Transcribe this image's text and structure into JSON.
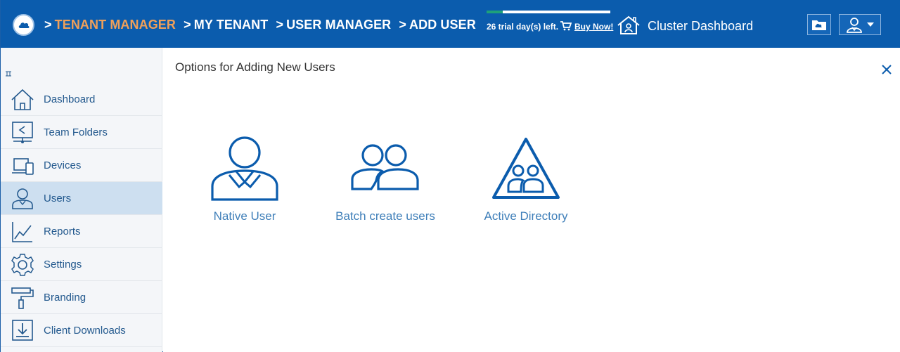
{
  "header": {
    "breadcrumb": [
      {
        "label": "TENANT MANAGER",
        "color": "#f0a05a"
      },
      {
        "label": "MY TENANT",
        "color": "#ffffff"
      },
      {
        "label": "USER MANAGER",
        "color": "#ffffff"
      },
      {
        "label": "ADD USER",
        "color": "#ffffff"
      }
    ],
    "separator": ">",
    "trial_text": "26 trial day(s) left.",
    "trial_progress": 0.13,
    "buy_now": "Buy Now!",
    "cluster_dashboard": "Cluster Dashboard",
    "icons": [
      "cloud-logo-icon",
      "cart-icon",
      "house-icon",
      "folder-icon",
      "user-icon",
      "caret-down-icon"
    ]
  },
  "sidebar": {
    "items": [
      {
        "label": "Dashboard",
        "icon": "home-icon",
        "active": false
      },
      {
        "label": "Team Folders",
        "icon": "team-folder-icon",
        "active": false
      },
      {
        "label": "Devices",
        "icon": "devices-icon",
        "active": false
      },
      {
        "label": "Users",
        "icon": "users-icon",
        "active": true
      },
      {
        "label": "Reports",
        "icon": "reports-icon",
        "active": false
      },
      {
        "label": "Settings",
        "icon": "gear-icon",
        "active": false
      },
      {
        "label": "Branding",
        "icon": "paint-roller-icon",
        "active": false
      },
      {
        "label": "Client Downloads",
        "icon": "download-icon",
        "active": false
      }
    ]
  },
  "main": {
    "title": "Options for Adding New Users",
    "options": [
      {
        "label": "Native User",
        "icon": "native-user-icon"
      },
      {
        "label": "Batch create users",
        "icon": "batch-users-icon"
      },
      {
        "label": "Active Directory",
        "icon": "active-directory-icon"
      }
    ]
  },
  "colors": {
    "header_bg": "#0b5cad",
    "accent_orange": "#f0a05a",
    "icon_blue": "#0b5cad",
    "label_blue": "#3f7fb9",
    "active_bg": "#cddff0"
  }
}
